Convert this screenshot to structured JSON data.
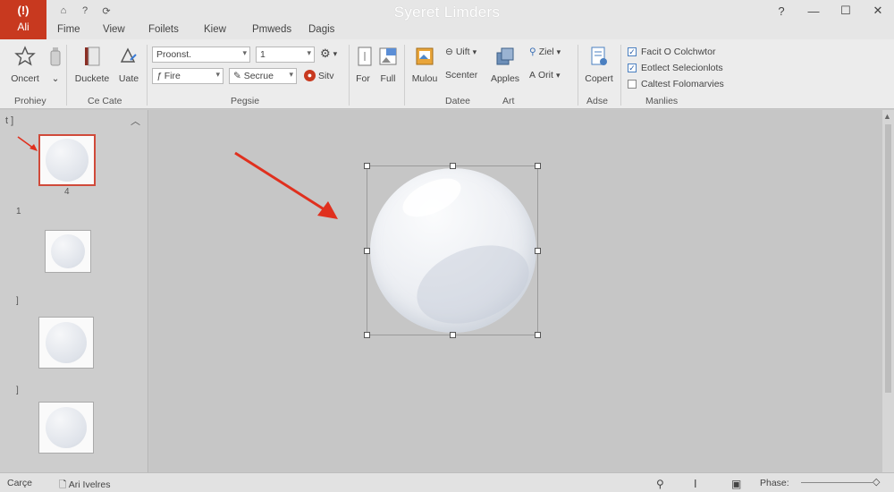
{
  "window": {
    "title": "Syeret Limders",
    "file_tab_icon": "(!)",
    "file_tab_label": "Ali"
  },
  "quick_access": [
    "home-icon",
    "help-icon",
    "history-icon"
  ],
  "tabs": [
    "Fime",
    "View",
    "Foilets",
    "Kiew",
    "Pmweds",
    "Dagis"
  ],
  "ribbon": {
    "groups": {
      "g1": "Prohiey",
      "g2": "Ce Cate",
      "g3": "Pegsie",
      "g4": "Datee",
      "g5": "Art",
      "g6": "Adse",
      "g7": "Manlies"
    },
    "buttons": {
      "oncert": "Oncert",
      "duckete": "Duckete",
      "uate": "Uate",
      "for": "For",
      "full": "Full",
      "mulou": "Mulou",
      "scenter": "Scenter",
      "apples": "Apples",
      "copert": "Copert",
      "uift": "Uift",
      "ziel": "Ziel",
      "orit": "Orit",
      "sitv": "Sitv"
    },
    "combos": {
      "font_name": "Proonst.",
      "font_size": "1",
      "fire": "Fire",
      "secrue": "Secrue"
    },
    "checkboxes": [
      {
        "label": "Facit O Colchwtor",
        "checked": true
      },
      {
        "label": "Eotlect Selecionlots",
        "checked": true
      },
      {
        "label": "Caltest Folomarvies",
        "checked": false
      }
    ]
  },
  "panel": {
    "header": "t ]",
    "slides": [
      {
        "num": "",
        "selected": true,
        "caption": "4"
      },
      {
        "num": "1",
        "selected": false
      },
      {
        "num": "]",
        "selected": false
      },
      {
        "num": "]",
        "selected": false
      }
    ]
  },
  "status": {
    "left": "Carçe",
    "notes": "Ari Ivelres",
    "right": "Phase:"
  },
  "colors": {
    "accent": "#c8391f",
    "arrow": "#e0301e",
    "selection": "#d04a3a"
  }
}
